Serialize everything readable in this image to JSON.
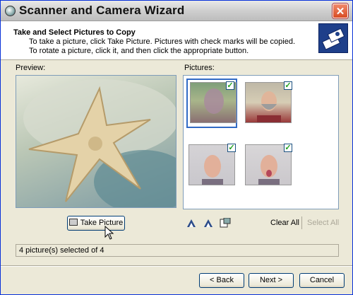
{
  "window": {
    "title": "Scanner and Camera Wizard",
    "close_label": "✕"
  },
  "header": {
    "title": "Take and Select Pictures to Copy",
    "description": "To take a picture, click Take Picture. Pictures with check marks will be copied. To rotate a picture, click it, and then click the appropriate button.",
    "icon": "scanner-camera-icon"
  },
  "preview": {
    "label": "Preview:",
    "image": "starfish-photo"
  },
  "pictures": {
    "label": "Pictures:",
    "thumbnails": [
      {
        "subject": "blurry-face",
        "checked": true,
        "selected": true
      },
      {
        "subject": "bearded-man",
        "checked": true,
        "selected": false
      },
      {
        "subject": "man-face",
        "checked": true,
        "selected": false
      },
      {
        "subject": "man-tongue-out",
        "checked": true,
        "selected": false
      }
    ]
  },
  "toolbar": {
    "take_picture": "Take Picture",
    "rotate_left_icon": "rotate-left-icon",
    "rotate_right_icon": "rotate-right-icon",
    "properties_icon": "properties-icon",
    "clear_all": "Clear All",
    "select_all": "Select All"
  },
  "status": {
    "text": "4 picture(s) selected of 4"
  },
  "footer": {
    "back": "< Back",
    "next": "Next >",
    "cancel": "Cancel"
  }
}
